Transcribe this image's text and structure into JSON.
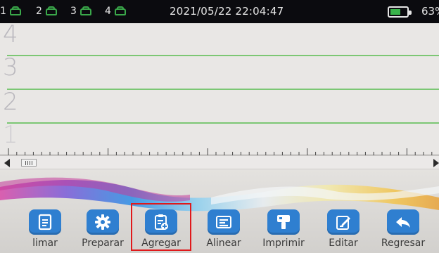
{
  "status_bar": {
    "heads": [
      {
        "number": "1",
        "icon": "printhead-icon"
      },
      {
        "number": "2",
        "icon": "printhead-icon"
      },
      {
        "number": "3",
        "icon": "printhead-icon"
      },
      {
        "number": "4",
        "icon": "printhead-icon"
      }
    ],
    "datetime": "2021/05/22 22:04:47",
    "battery_percent_text": "63%",
    "battery_level": 0.63,
    "colors": {
      "bar_bg": "#0b0b0f",
      "head_icon": "#3aa84a",
      "battery_fill": "#39b44a"
    }
  },
  "canvas": {
    "row_numbers": [
      "4",
      "3",
      "2",
      "1"
    ],
    "colors": {
      "row_line": "#7cc774",
      "row_number": "#b9b7bd"
    }
  },
  "toolbar": {
    "buttons": [
      {
        "label": "limar",
        "icon": "document-icon"
      },
      {
        "label": "Preparar",
        "icon": "gear-icon"
      },
      {
        "label": "Agregar",
        "icon": "clipboard-add-icon",
        "highlighted": true
      },
      {
        "label": "Alinear",
        "icon": "align-left-icon"
      },
      {
        "label": "Imprimir",
        "icon": "printer-icon"
      },
      {
        "label": "Editar",
        "icon": "edit-icon"
      },
      {
        "label": "Regresar",
        "icon": "return-arrow-icon"
      }
    ],
    "colors": {
      "tile": "#2f7fd0",
      "highlight_border": "#e0191b"
    }
  }
}
